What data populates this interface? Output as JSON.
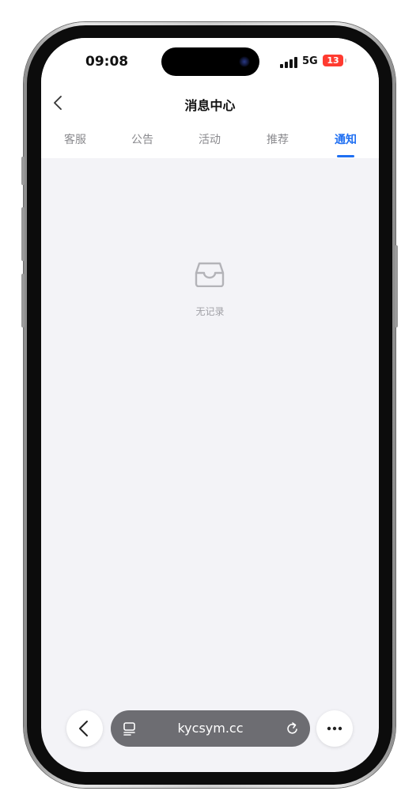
{
  "status": {
    "time": "09:08",
    "network": "5G",
    "battery": "13"
  },
  "nav": {
    "title": "消息中心"
  },
  "tabs": [
    {
      "label": "客服",
      "active": false
    },
    {
      "label": "公告",
      "active": false
    },
    {
      "label": "活动",
      "active": false
    },
    {
      "label": "推荐",
      "active": false
    },
    {
      "label": "通知",
      "active": true
    }
  ],
  "empty": {
    "text": "无记录",
    "icon": "inbox-icon"
  },
  "browser": {
    "url": "kycsym.cc"
  },
  "colors": {
    "accent": "#1f6ff2",
    "background": "#f3f3f7",
    "battery_low": "#ff3b30"
  }
}
